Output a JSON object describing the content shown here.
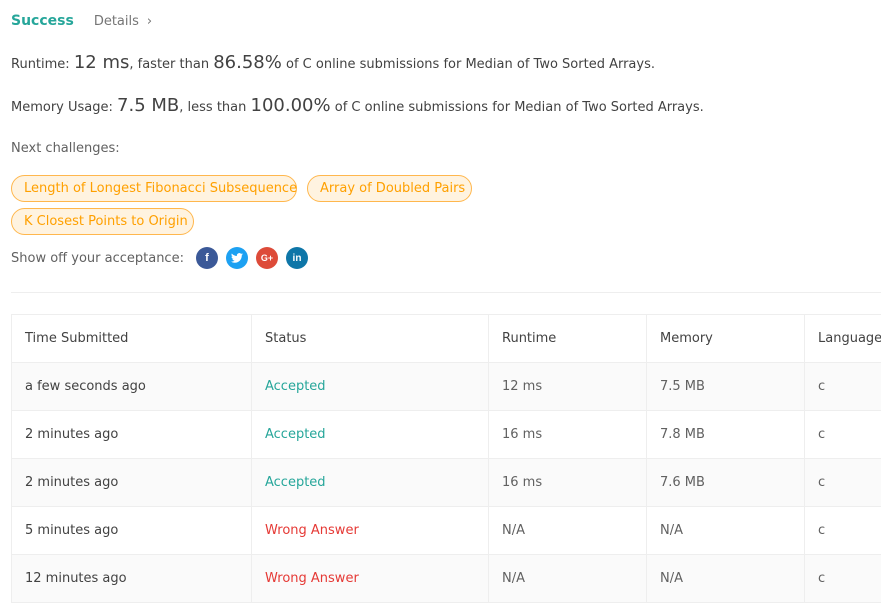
{
  "header": {
    "status": "Success",
    "details": "Details"
  },
  "runtime": {
    "label": "Runtime:",
    "value": "12 ms",
    "comparator": ", faster than",
    "percent": "86.58%",
    "suffix": "of C online submissions for Median of Two Sorted Arrays."
  },
  "memory": {
    "label": "Memory Usage:",
    "value": "7.5 MB",
    "comparator": ", less than",
    "percent": "100.00%",
    "suffix": "of C online submissions for Median of Two Sorted Arrays."
  },
  "next": {
    "label": "Next challenges:",
    "challenges": [
      "Length of Longest Fibonacci Subsequence",
      "Array of Doubled Pairs",
      "K Closest Points to Origin"
    ]
  },
  "share": {
    "label": "Show off your acceptance:",
    "icons": [
      "facebook-icon",
      "twitter-icon",
      "google-plus-icon",
      "linkedin-icon"
    ]
  },
  "colors": {
    "accent": "#26a69a",
    "error": "#e53935",
    "tag_text": "#ffa000",
    "tag_border": "#ffb74d"
  },
  "table": {
    "headers": [
      "Time Submitted",
      "Status",
      "Runtime",
      "Memory",
      "Language"
    ],
    "rows": [
      {
        "time": "a few seconds ago",
        "status": "Accepted",
        "runtime": "12 ms",
        "memory": "7.5 MB",
        "language": "c"
      },
      {
        "time": "2 minutes ago",
        "status": "Accepted",
        "runtime": "16 ms",
        "memory": "7.8 MB",
        "language": "c"
      },
      {
        "time": "2 minutes ago",
        "status": "Accepted",
        "runtime": "16 ms",
        "memory": "7.6 MB",
        "language": "c"
      },
      {
        "time": "5 minutes ago",
        "status": "Wrong Answer",
        "runtime": "N/A",
        "memory": "N/A",
        "language": "c"
      },
      {
        "time": "12 minutes ago",
        "status": "Wrong Answer",
        "runtime": "N/A",
        "memory": "N/A",
        "language": "c"
      }
    ]
  }
}
